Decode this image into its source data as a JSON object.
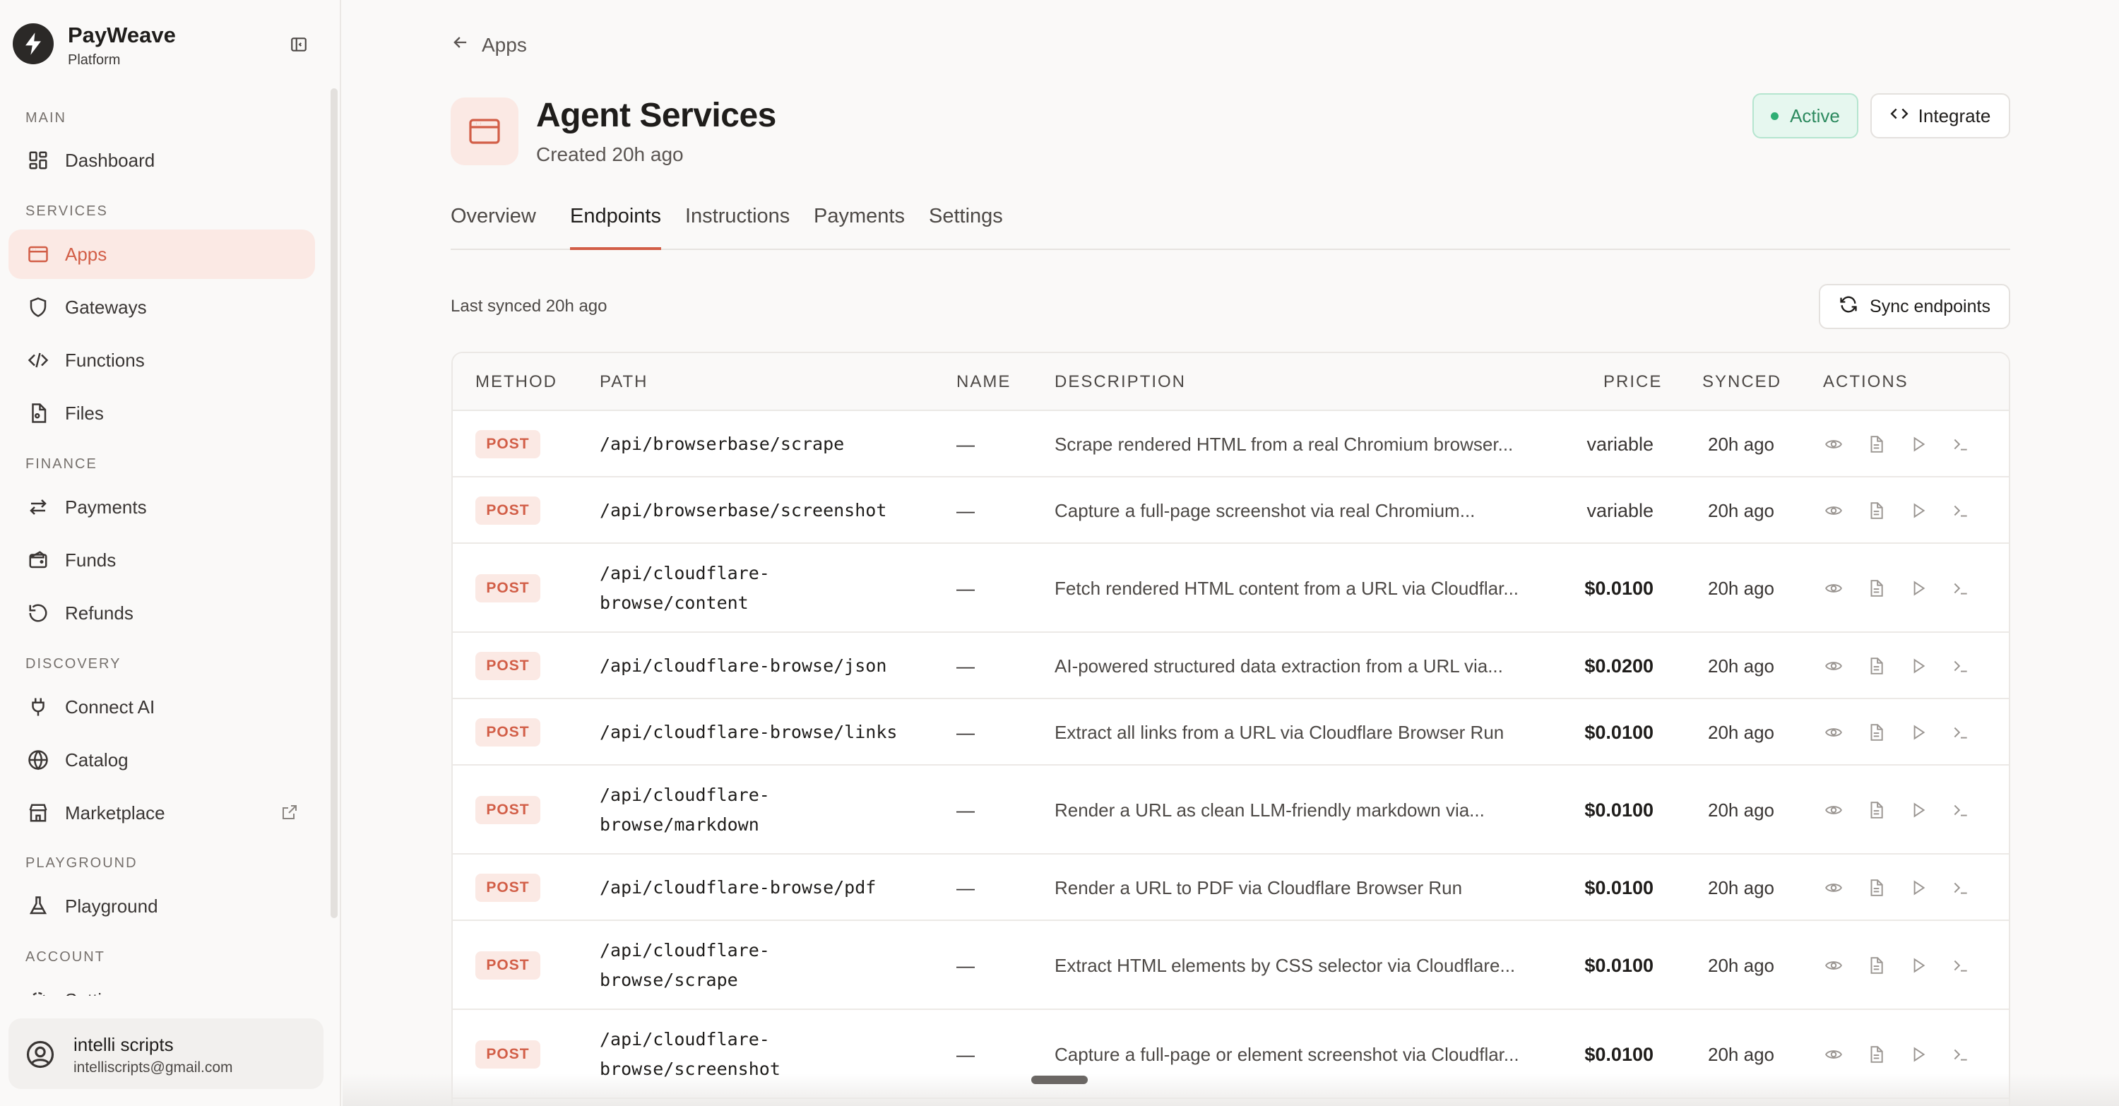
{
  "brand": {
    "name": "PayWeave",
    "sub": "Platform"
  },
  "sidebar": {
    "sections": [
      {
        "label": "MAIN"
      },
      {
        "label": "SERVICES"
      },
      {
        "label": "FINANCE"
      },
      {
        "label": "DISCOVERY"
      },
      {
        "label": "PLAYGROUND"
      },
      {
        "label": "ACCOUNT"
      }
    ],
    "items": [
      {
        "label": "Dashboard",
        "icon": "grid-icon"
      },
      {
        "label": "Apps",
        "icon": "app-window-icon"
      },
      {
        "label": "Gateways",
        "icon": "shield-icon"
      },
      {
        "label": "Functions",
        "icon": "code-icon"
      },
      {
        "label": "Files",
        "icon": "file-icon"
      },
      {
        "label": "Payments",
        "icon": "arrows-icon"
      },
      {
        "label": "Funds",
        "icon": "wallet-icon"
      },
      {
        "label": "Refunds",
        "icon": "rotate-ccw-icon"
      },
      {
        "label": "Connect AI",
        "icon": "plug-icon"
      },
      {
        "label": "Catalog",
        "icon": "globe-icon"
      },
      {
        "label": "Marketplace",
        "icon": "store-icon"
      },
      {
        "label": "Playground",
        "icon": "flask-icon"
      },
      {
        "label": "Settings",
        "icon": "gear-icon"
      }
    ]
  },
  "user": {
    "name": "intelli scripts",
    "email": "intelliscripts@gmail.com"
  },
  "header": {
    "back_label": "Apps",
    "title": "Agent Services",
    "created": "Created 20h ago",
    "status": "Active",
    "integrate_label": "Integrate"
  },
  "tabs": [
    {
      "label": "Overview"
    },
    {
      "label": "Endpoints"
    },
    {
      "label": "Instructions"
    },
    {
      "label": "Payments"
    },
    {
      "label": "Settings"
    }
  ],
  "active_tab": "Endpoints",
  "sync": {
    "last_synced": "Last synced 20h ago",
    "button_label": "Sync endpoints"
  },
  "table": {
    "columns": [
      "METHOD",
      "PATH",
      "NAME",
      "DESCRIPTION",
      "PRICE",
      "SYNCED",
      "ACTIONS"
    ],
    "rows": [
      {
        "method": "POST",
        "path1": "/api/browserbase/scrape",
        "path2": "",
        "name": "—",
        "description": "Scrape rendered HTML from a real Chromium browser...",
        "price": "variable",
        "synced": "20h ago"
      },
      {
        "method": "POST",
        "path1": "/api/browserbase/screenshot",
        "path2": "",
        "name": "—",
        "description": "Capture a full-page screenshot via real Chromium...",
        "price": "variable",
        "synced": "20h ago"
      },
      {
        "method": "POST",
        "path1": "/api/cloudflare-",
        "path2": "browse/content",
        "name": "—",
        "description": "Fetch rendered HTML content from a URL via Cloudflar...",
        "price": "$0.0100",
        "synced": "20h ago"
      },
      {
        "method": "POST",
        "path1": "/api/cloudflare-browse/json",
        "path2": "",
        "name": "—",
        "description": "AI-powered structured data extraction from a URL via...",
        "price": "$0.0200",
        "synced": "20h ago"
      },
      {
        "method": "POST",
        "path1": "/api/cloudflare-browse/links",
        "path2": "",
        "name": "—",
        "description": "Extract all links from a URL via Cloudflare Browser Run",
        "price": "$0.0100",
        "synced": "20h ago"
      },
      {
        "method": "POST",
        "path1": "/api/cloudflare-",
        "path2": "browse/markdown",
        "name": "—",
        "description": "Render a URL as clean LLM-friendly markdown via...",
        "price": "$0.0100",
        "synced": "20h ago"
      },
      {
        "method": "POST",
        "path1": "/api/cloudflare-browse/pdf",
        "path2": "",
        "name": "—",
        "description": "Render a URL to PDF via Cloudflare Browser Run",
        "price": "$0.0100",
        "synced": "20h ago"
      },
      {
        "method": "POST",
        "path1": "/api/cloudflare-",
        "path2": "browse/scrape",
        "name": "—",
        "description": "Extract HTML elements by CSS selector via Cloudflare...",
        "price": "$0.0100",
        "synced": "20h ago"
      },
      {
        "method": "POST",
        "path1": "/api/cloudflare-",
        "path2": "browse/screenshot",
        "name": "—",
        "description": "Capture a full-page or element screenshot via Cloudflar...",
        "price": "$0.0100",
        "synced": "20h ago"
      }
    ],
    "row_actions": [
      "eye-icon",
      "doc-icon",
      "play-icon",
      "terminal-icon"
    ]
  },
  "colors": {
    "accent": "#d25e47",
    "accent_bg": "#fbe9e4",
    "active_green": "#2fae74"
  }
}
